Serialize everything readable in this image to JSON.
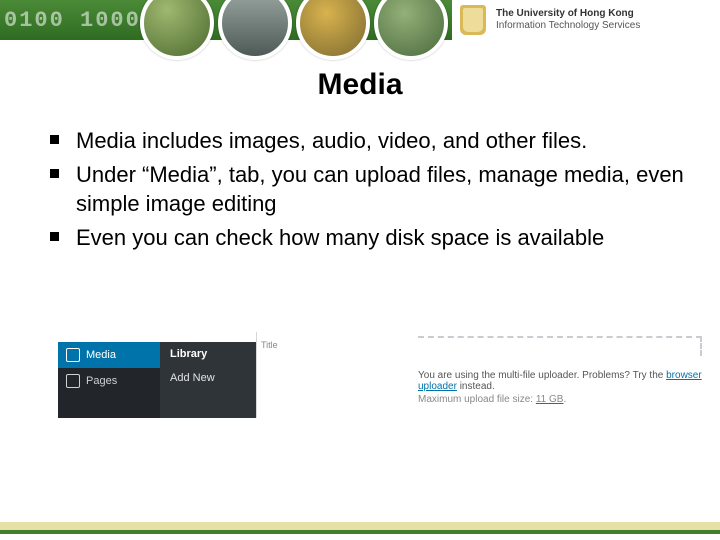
{
  "header": {
    "binary_bg_text": "0100     10001",
    "org_line1": "The University of Hong Kong",
    "org_line2": "Information Technology Services"
  },
  "title": "Media",
  "bullets": [
    "Media includes images, audio, video, and other files.",
    "Under “Media”, tab, you can upload files, manage media, even simple image editing",
    "Even you can check how many disk space is available"
  ],
  "wp_menu": {
    "media_label": "Media",
    "pages_label": "Pages",
    "sub_library": "Library",
    "sub_addnew": "Add New",
    "partial_header": "Title"
  },
  "upload_box": {
    "line1_pre": "You are using the multi-file uploader. Problems? Try the ",
    "line1_link": "browser uploader",
    "line1_post": " instead.",
    "line2_pre": "Maximum upload file size: ",
    "line2_size": "11 GB"
  }
}
